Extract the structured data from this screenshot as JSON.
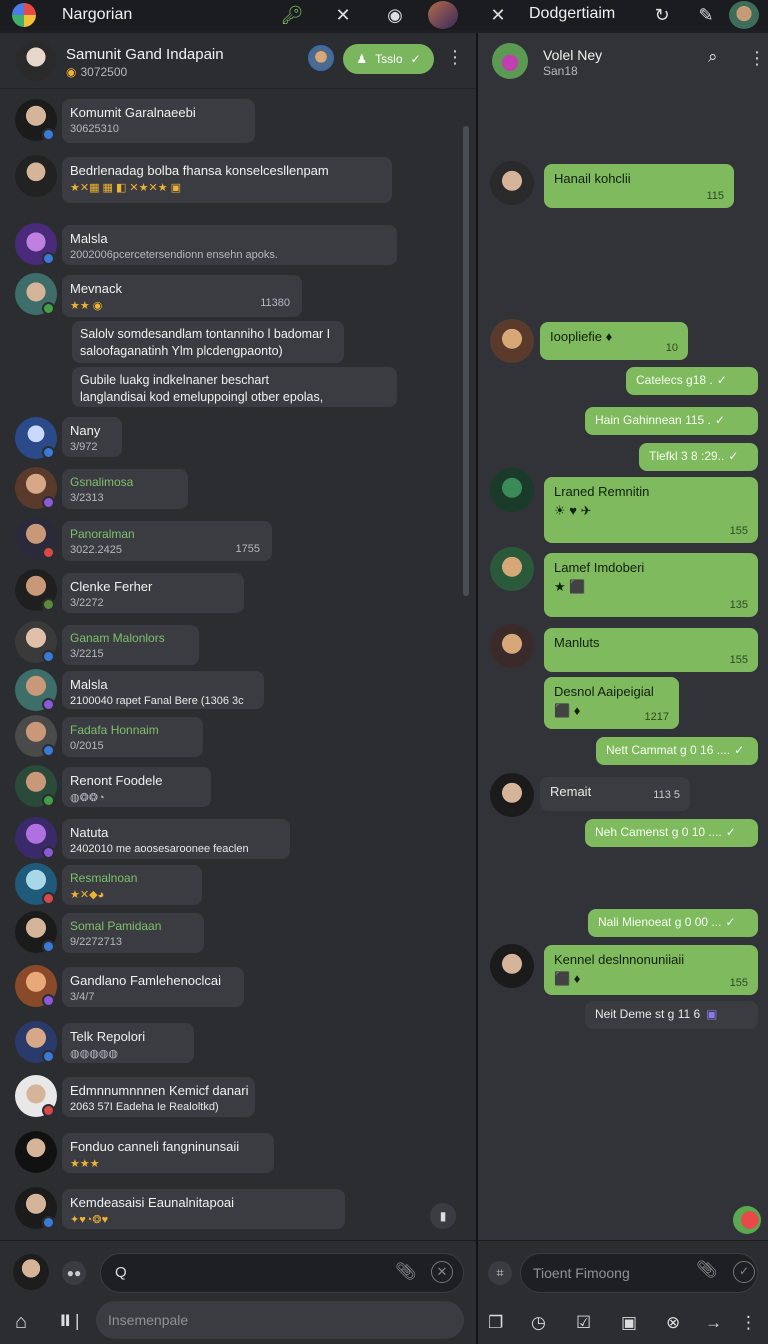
{
  "topbar": {
    "left_title": "Nargorian",
    "right_title": "Dodgertiaim"
  },
  "left_header": {
    "name": "Samunit Gand Indapain",
    "sub": "3072500",
    "button_label": "Tsslo"
  },
  "conversations": [
    {
      "title": "Komumit Garalnaeebi",
      "sub": "30625310",
      "title_color": "white"
    },
    {
      "title": "Bedrlenadag bolba fhansa konselcesllenpam",
      "sub": "★✕▦ ▦ ◧ ✕★✕★ ▣",
      "title_color": "white"
    },
    {
      "title": "Malsla",
      "sub": "2002006pcercetersendionn ensehn apoks.",
      "title_color": "white"
    },
    {
      "title": "Mevnack",
      "sub": "★★ ◉",
      "time": "11380",
      "title_color": "white"
    },
    {
      "title": "Salolv somdesandlam tontanniho l badomar I",
      "sub": "saloofaganatinh Ylm plcdengpaonto)",
      "title_color": "white"
    },
    {
      "title": "Gubile luakg indkelnaner beschart",
      "sub": "langlandisai kod emeluppoingl otber epolas,",
      "title_color": "white"
    },
    {
      "title": "Nany",
      "sub": "3/972",
      "title_color": "white"
    },
    {
      "title": "Gsnalimosa",
      "sub": "3/2313",
      "title_color": "green"
    },
    {
      "title": "Panoralman",
      "sub": "3022.2425",
      "time": "1755",
      "title_color": "green"
    },
    {
      "title": "Clenke Ferher",
      "sub": "3/2272",
      "title_color": "white"
    },
    {
      "title": "Ganam Malonlors",
      "sub": "3/2215",
      "title_color": "green"
    },
    {
      "title": "Malsla",
      "sub": "2100040 rapet Fanal Bere (1306 3c",
      "title_color": "white"
    },
    {
      "title": "Fadafa Honnaim",
      "sub": "0/2015",
      "title_color": "green"
    },
    {
      "title": "Renont Foodele",
      "sub": "◍❂❂◔",
      "title_color": "white"
    },
    {
      "title": "Natuta",
      "sub": "2402010 me aoosesaroonee feaclen",
      "title_color": "white"
    },
    {
      "title": "Resmalnoan",
      "sub": "★✕◆◕",
      "title_color": "green"
    },
    {
      "title": "Somal Pamidaan",
      "sub": "9/2272713",
      "title_color": "green"
    },
    {
      "title": "Gandlano Famlehenoclcai",
      "sub": "3/4/7",
      "title_color": "white"
    },
    {
      "title": "Telk Repolori",
      "sub": "◍◍◍◍◍",
      "title_color": "white"
    },
    {
      "title": "Edmnnumnnnen Kemicf danari",
      "sub": "2063 57I Eadeha Ie Realoltkd)",
      "title_color": "green"
    },
    {
      "title": "Fonduo canneli fangninunsaii",
      "sub": "★★★",
      "title_color": "white"
    },
    {
      "title": "Kemdeasaisi Eaunalnitapoai",
      "sub": "✦♥◔❂♥",
      "title_color": "white"
    }
  ],
  "left_footer": {
    "input_placeholder": "Q",
    "search_placeholder": "Insemenpale"
  },
  "right_header": {
    "name": "Volel Ney",
    "sub": "San18"
  },
  "messages": [
    {
      "kind": "in",
      "text": "Hanail kohclii",
      "time": "115"
    },
    {
      "kind": "in",
      "text": "Ioopliefie",
      "time": "10"
    },
    {
      "kind": "out",
      "text": "Catelecs g18 ."
    },
    {
      "kind": "out",
      "text": "Hain Gahinnean 115 ."
    },
    {
      "kind": "out",
      "text": "Tlefkl 3 8 :29.."
    },
    {
      "kind": "in",
      "text": "Lraned Remnitin",
      "time": "155"
    },
    {
      "kind": "in",
      "text": "Lamef Imdoberi",
      "time": "135"
    },
    {
      "kind": "in",
      "text": "Manluts",
      "time": "155"
    },
    {
      "kind": "in",
      "text": "Desnol Aaipeigial",
      "time": "1217"
    },
    {
      "kind": "out",
      "text": "Nett Cammat g 0 16 ...."
    },
    {
      "kind": "in_grey",
      "text": "Remait",
      "time": "113 5"
    },
    {
      "kind": "out",
      "text": "Neh Camenst g 0 10 ...."
    },
    {
      "kind": "out",
      "text": "Nali Mienoeat g 0 00 ..."
    },
    {
      "kind": "in",
      "text": "Kennel deslnnonuniiaii",
      "time": "155"
    },
    {
      "kind": "out_grey",
      "text": "Neit Deme st g 11 6"
    }
  ],
  "right_footer": {
    "input_placeholder": "Tioent Fimoong"
  },
  "colors": {
    "accent_green": "#7fba5e",
    "panel_left": "#2b2d31",
    "panel_right": "#313338"
  }
}
